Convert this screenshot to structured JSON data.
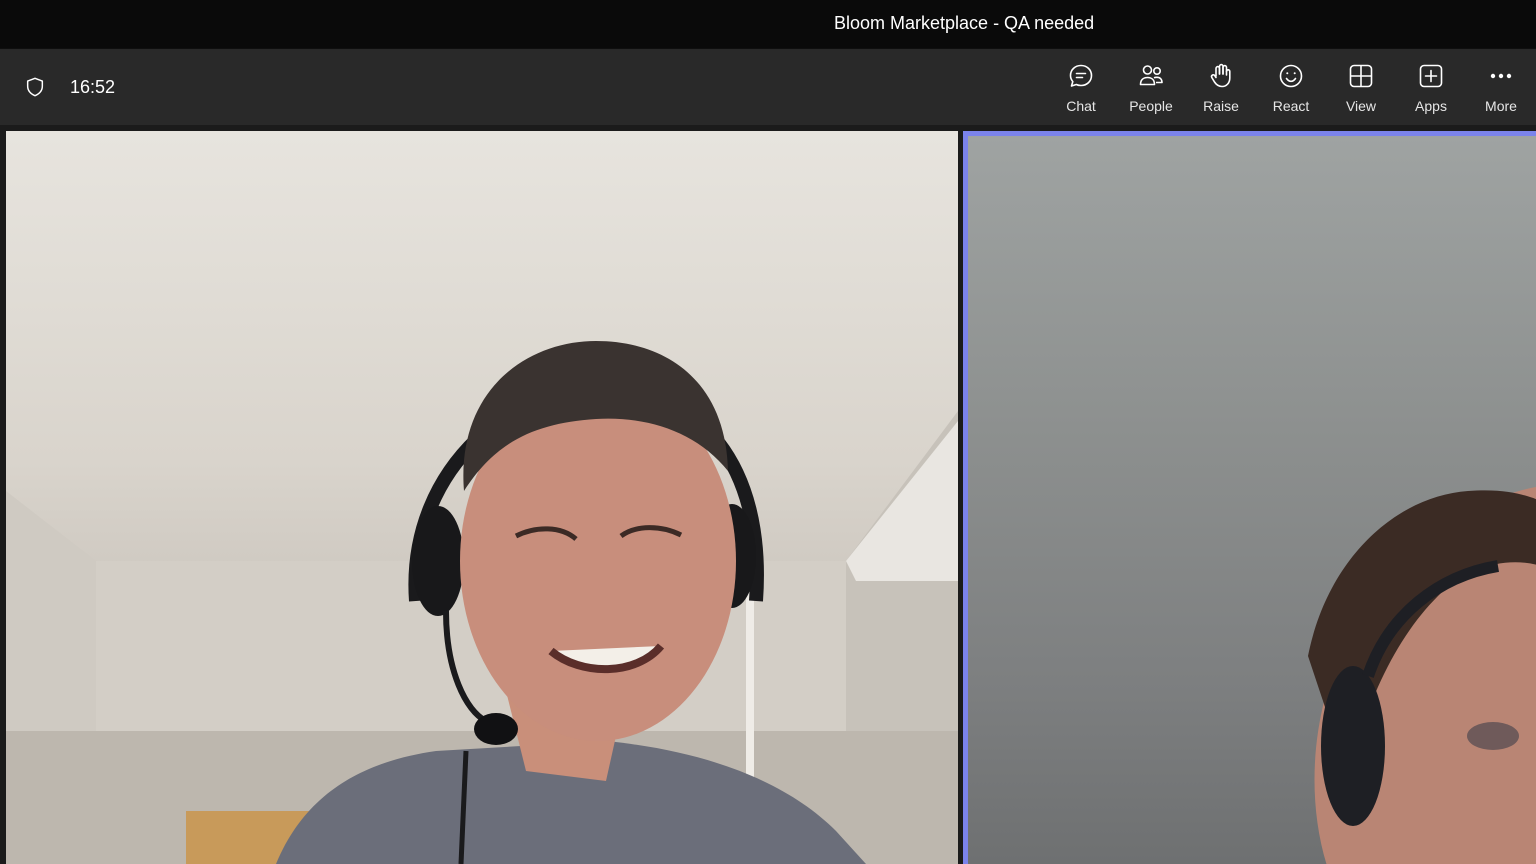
{
  "window": {
    "title": "Bloom Marketplace - QA needed"
  },
  "meeting": {
    "elapsed_time": "16:52",
    "security_icon": "shield-icon"
  },
  "toolbar": {
    "items": [
      {
        "label": "Chat",
        "icon": "chat-icon"
      },
      {
        "label": "People",
        "icon": "people-icon"
      },
      {
        "label": "Raise",
        "icon": "raise-hand-icon"
      },
      {
        "label": "React",
        "icon": "smiley-icon"
      },
      {
        "label": "View",
        "icon": "grid-view-icon"
      },
      {
        "label": "Apps",
        "icon": "apps-plus-icon"
      },
      {
        "label": "More",
        "icon": "more-dots-icon"
      }
    ]
  },
  "colors": {
    "titlebar_bg": "#0a0a0a",
    "toolbar_bg": "#292929",
    "active_speaker_border": "#7b83eb"
  }
}
